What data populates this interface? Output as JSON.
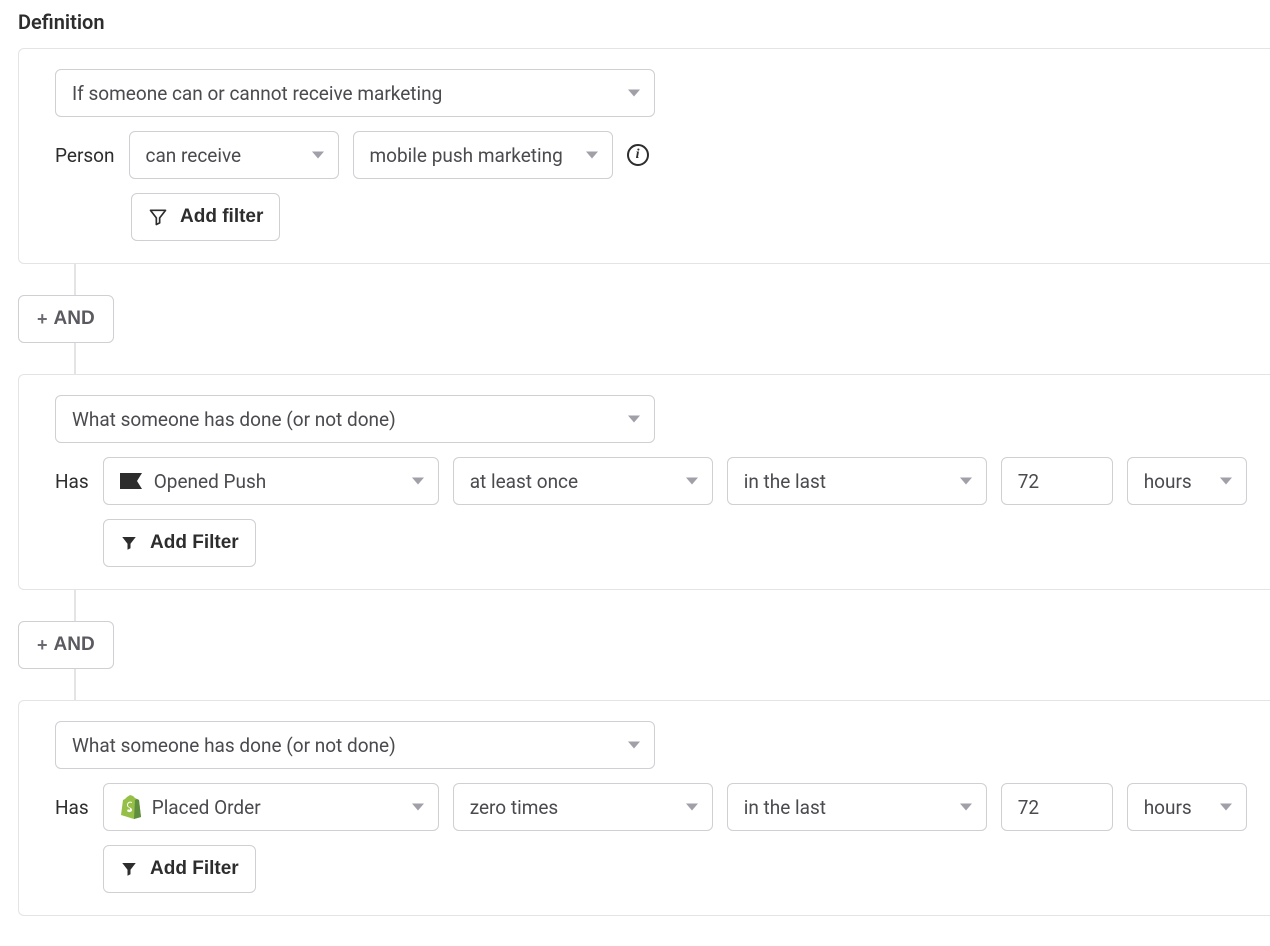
{
  "title": "Definition",
  "block1": {
    "condition_type": "If someone can or cannot receive marketing",
    "subject_label": "Person",
    "can_select": "can receive",
    "channel_select": "mobile push marketing",
    "add_filter_label": "Add filter"
  },
  "and_label": "AND",
  "block2": {
    "condition_type": "What someone has done (or not done)",
    "subject_label": "Has",
    "event": "Opened Push",
    "frequency": "at least once",
    "timeframe": "in the last",
    "time_value": "72",
    "time_unit": "hours",
    "add_filter_label": "Add Filter"
  },
  "block3": {
    "condition_type": "What someone has done (or not done)",
    "subject_label": "Has",
    "event": "Placed Order",
    "frequency": "zero times",
    "timeframe": "in the last",
    "time_value": "72",
    "time_unit": "hours",
    "add_filter_label": "Add Filter"
  }
}
